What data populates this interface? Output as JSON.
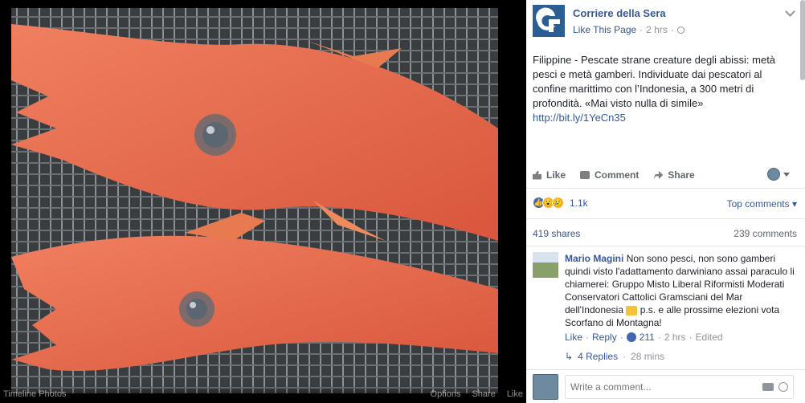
{
  "photo": {
    "footer_left": "Timeline Photos",
    "footer_actions": [
      "Options",
      "Share",
      "Like"
    ]
  },
  "post": {
    "page_name": "Corriere della Sera",
    "avatar_text": "CdS",
    "like_page": "Like This Page",
    "time": "2 hrs",
    "text": "Filippine - Pescate strane creature degli abissi: metà pesci e metà gamberi. Individuate dai pescatori al confine marittimo con l’Indonesia, a 300 metri di profondità. «Mai visto nulla di simile»",
    "link": "http://bit.ly/1YeCn35"
  },
  "actions": {
    "like": "Like",
    "comment": "Comment",
    "share": "Share"
  },
  "stats": {
    "reactions_count": "1.1k",
    "top_comments": "Top comments",
    "shares": "419 shares",
    "comments": "239 comments"
  },
  "comment": {
    "author": "Mario Magini",
    "text": "Non sono pesci, non sono gamberi quindi visto l'adattamento darwiniano assai paraculo li chiamerei: Gruppo Misto Liberal Riformisti Moderati Conservatori Cattolici Gramsciani del Mar dell'Indonesia",
    "text_after": "p.s. e alle prossime elezioni vota Scorfano di Montagna!",
    "like": "Like",
    "reply": "Reply",
    "likes": "211",
    "time": "2 hrs",
    "edited": "Edited",
    "replies": "4 Replies",
    "replies_time": "28 mins"
  },
  "composer": {
    "placeholder": "Write a comment..."
  },
  "colors": {
    "link": "#365899",
    "brand": "#2b5d97",
    "fish": "#e8654a"
  },
  "icons": [
    "globe-icon",
    "chevron-down-icon",
    "like-icon",
    "comment-icon",
    "share-icon",
    "camera-icon",
    "emoji-icon"
  ]
}
